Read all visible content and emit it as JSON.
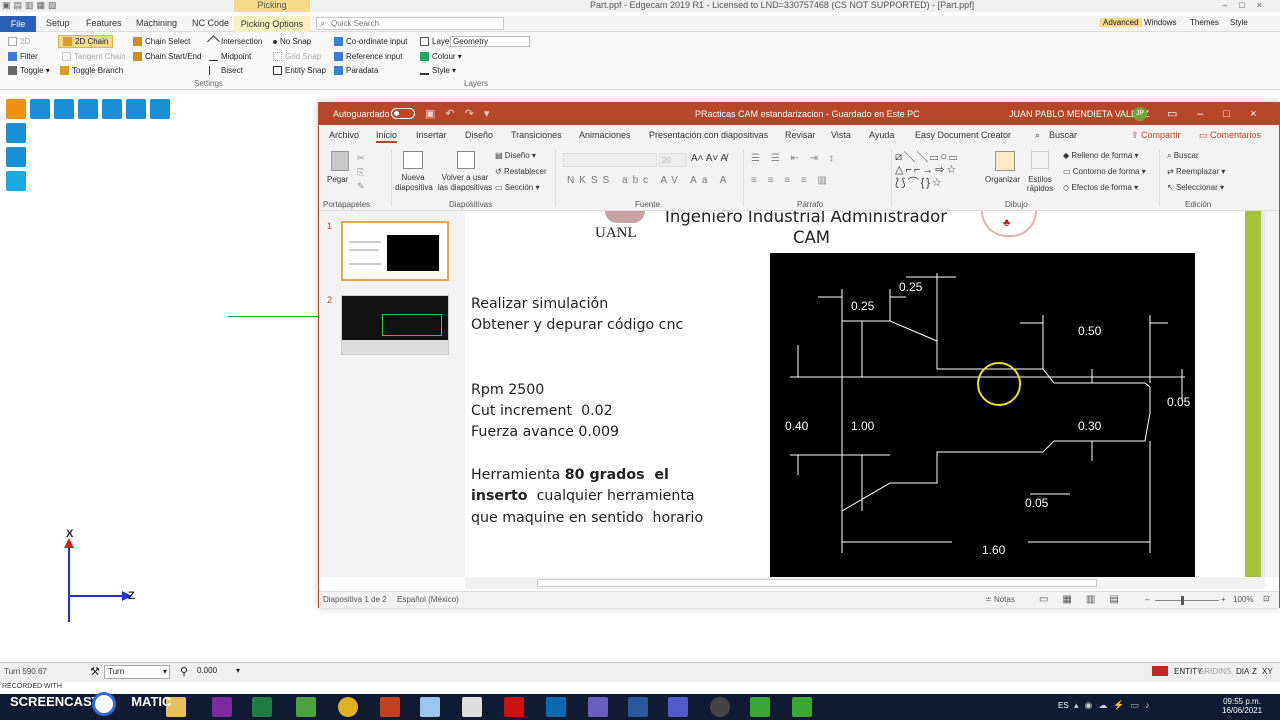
{
  "edgecam": {
    "title": "Part.ppf - Edgecam 2019 R1 - Licensed to LND=330757468 (CS NOT SUPPORTED) - [Part.ppf]",
    "context_tab": "Picking",
    "menu": [
      "File",
      "Setup",
      "Features",
      "Machining",
      "NC Code",
      "Picking Options"
    ],
    "quick_search": "Quick Search",
    "right_menu": [
      "Advanced",
      "Windows",
      "Themes",
      "Style"
    ],
    "ribbon": {
      "col1": [
        "2D",
        "Filter",
        "Toggle"
      ],
      "col2": [
        "2D Chain",
        "Tangent Chain",
        "Toggle Branch"
      ],
      "col3": [
        "Chain Select",
        "Chain Start/End"
      ],
      "col4": [
        "Intersection",
        "Midpoint",
        "Bisect"
      ],
      "col5": [
        "No Snap",
        "Grid Snap",
        "Entity Snap"
      ],
      "col6": [
        "Co-ordinate input",
        "Reference input",
        "Paradata"
      ],
      "layer_label": "Layer",
      "layer_value": "Geometry",
      "colour": "Colour",
      "style": "Style",
      "group_settings": "Settings",
      "group_layers": "Layers"
    },
    "axis_x": "X",
    "axis_z": "Z",
    "status": {
      "coord": "Turn 590.67",
      "mode": "Turn",
      "value": "0.000",
      "right_items": [
        "ENTITY",
        "GRID",
        "INS",
        "DIA",
        "Z",
        "XY"
      ]
    }
  },
  "powerpoint": {
    "autosave": "Autoguardado",
    "title": "PRacticas CAM estandarizacion  -  Guardado en Este PC",
    "user": "JUAN PABLO MENDIETA VALDEZ",
    "user_initials": "JP",
    "tabs": [
      "Archivo",
      "Inicio",
      "Insertar",
      "Diseño",
      "Transiciones",
      "Animaciones",
      "Presentación con diapositivas",
      "Revisar",
      "Vista",
      "Ayuda",
      "Easy Document Creator"
    ],
    "search": "Buscar",
    "share": "Compartir",
    "comments": "Comentarios",
    "ribbon": {
      "paste": "Pegar",
      "new_slide": "Nueva diapositiva",
      "reuse": "Volver a usar las diapositivas",
      "layout": "Diseño",
      "reset": "Restablecer",
      "section": "Sección",
      "font_size": "20",
      "organize": "Organizar",
      "quick_styles": "Estilos rápidos",
      "fill": "Relleno de forma",
      "outline": "Contorno de forma",
      "effects": "Efectos de forma",
      "find": "Buscar",
      "replace": "Reemplazar",
      "select": "Seleccionar",
      "groups": [
        "Portapapeles",
        "Diapositivas",
        "Fuente",
        "Párrafo",
        "Dibujo",
        "Edición"
      ]
    },
    "thumbs": [
      "1",
      "2"
    ],
    "slide": {
      "logo": "UANL",
      "title_line1": "Ingeniero Industrial Administrador",
      "title_line2": "CAM",
      "lines_a": [
        "Realizar simulación",
        "Obtener y depurar código cnc"
      ],
      "lines_b": [
        "Rpm 2500",
        "Cut increment  0.02",
        "Fuerza avance 0.009"
      ],
      "tool_a": "Herramienta ",
      "tool_bold1": "80 grados  el",
      "tool_bold2": "inserto",
      "tool_b": "  cualquier herramienta",
      "tool_c": "que maquine en sentido  horario",
      "dims": {
        "d025a": "0.25",
        "d025b": "0.25",
        "d050": "0.50",
        "d040": "0.40",
        "d100": "1.00",
        "d030": "0.30",
        "d005a": "0.05",
        "d005b": "0.05",
        "d160": "1.60"
      }
    },
    "status": {
      "slide": "Diapositiva 1 de 2",
      "lang": "Español (México)",
      "notes": "Notas",
      "zoom": "100%"
    }
  },
  "taskbar": {
    "recorded": "RECORDED WITH",
    "brand": "SCREENCAST",
    "brand2": "MATIC",
    "lang": "ES",
    "time": "09:55 p.m.",
    "date": "16/06/2021"
  }
}
